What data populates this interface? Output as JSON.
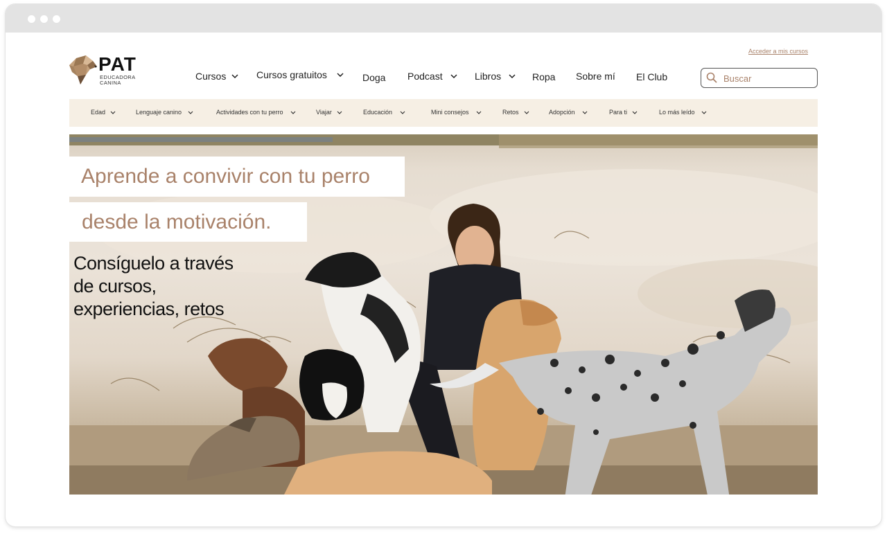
{
  "brand": {
    "name": "PAT",
    "tagline_line1": "EDUCADORA",
    "tagline_line2": "CANINA"
  },
  "header": {
    "access_link": "Acceder a mis cursos",
    "search_placeholder": "Buscar"
  },
  "main_nav": [
    {
      "label": "Cursos",
      "dropdown": true
    },
    {
      "label": "Cursos gratuitos",
      "dropdown": true
    },
    {
      "label": "Doga",
      "dropdown": false
    },
    {
      "label": "Podcast",
      "dropdown": true
    },
    {
      "label": "Libros",
      "dropdown": true
    },
    {
      "label": "Ropa",
      "dropdown": false
    },
    {
      "label": "Sobre mí",
      "dropdown": false
    },
    {
      "label": "El Club",
      "dropdown": false
    }
  ],
  "sub_nav": [
    {
      "label": "Edad"
    },
    {
      "label": "Lenguaje canino"
    },
    {
      "label": "Actividades con tu perro"
    },
    {
      "label": "Viajar"
    },
    {
      "label": "Educación"
    },
    {
      "label": "Mini consejos"
    },
    {
      "label": "Retos"
    },
    {
      "label": "Adopción"
    },
    {
      "label": "Para ti"
    },
    {
      "label": "Lo más leído"
    }
  ],
  "hero": {
    "headline_line1": "Aprende a convivir con tu perro",
    "headline_line2": "desde la motivación.",
    "subtitle_line1": "Consíguelo a través",
    "subtitle_line2": "de cursos,",
    "subtitle_line3": "experiencias, retos"
  },
  "colors": {
    "accent": "#a9826a",
    "subnav_bg": "#f6efe4",
    "text": "#222222",
    "titlebar": "#e3e3e3"
  }
}
